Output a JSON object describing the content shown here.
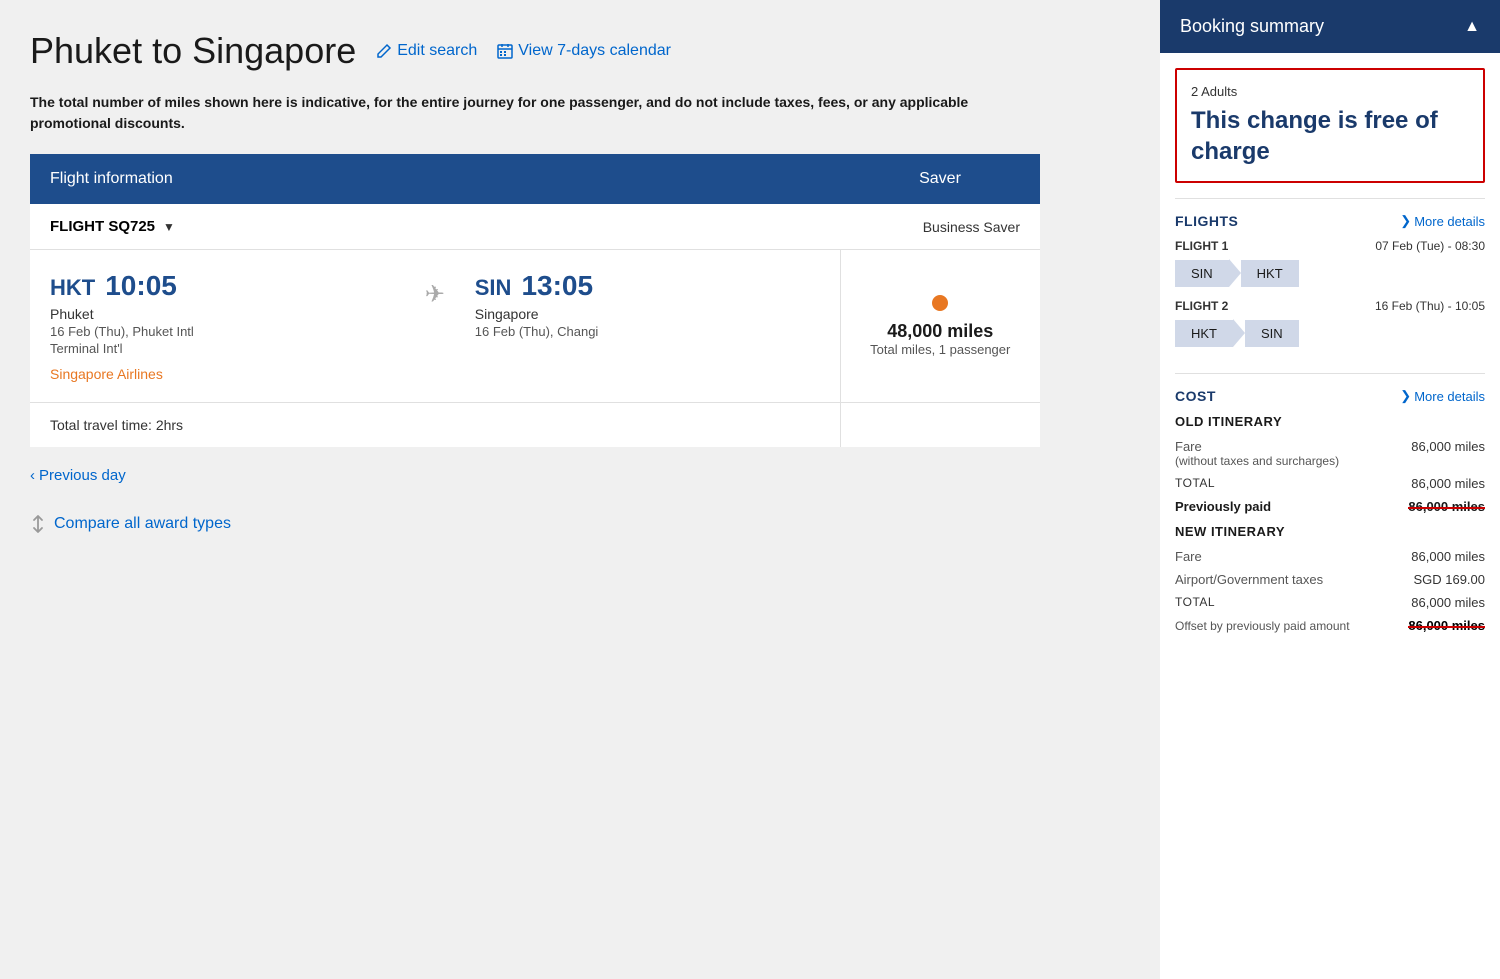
{
  "page": {
    "title": "Phuket to Singapore",
    "edit_search_label": "Edit search",
    "calendar_label": "View 7-days calendar",
    "disclaimer": "The total number of miles shown here is indicative, for the entire journey for one passenger, and do not include taxes, fees, or any applicable promotional discounts."
  },
  "table": {
    "header_flight_info": "Flight information",
    "header_saver": "Saver"
  },
  "flight": {
    "number": "FLIGHT SQ725",
    "fare_type": "Business Saver",
    "departure_code": "HKT",
    "departure_time": "10:05",
    "departure_city": "Phuket",
    "departure_date": "16 Feb (Thu), Phuket Intl",
    "departure_terminal": "Terminal Int'l",
    "arrival_code": "SIN",
    "arrival_time": "13:05",
    "arrival_city": "Singapore",
    "arrival_date": "16 Feb (Thu), Changi",
    "airline": "Singapore Airlines",
    "miles_amount": "48,000 miles",
    "miles_label": "Total miles, 1 passenger",
    "travel_time": "Total travel time: 2hrs"
  },
  "bottom_links": {
    "previous_day": "Previous day",
    "compare": "Compare all award types"
  },
  "sidebar": {
    "title": "Booking summary",
    "adults_label": "2 Adults",
    "free_charge_text": "This change is free of charge",
    "flights_section": "FLIGHTS",
    "more_details": "More details",
    "flight1_label": "FLIGHT 1",
    "flight1_date": "07 Feb (Tue) - 08:30",
    "flight1_from": "SIN",
    "flight1_to": "HKT",
    "flight2_label": "FLIGHT 2",
    "flight2_date": "16 Feb (Thu) - 10:05",
    "flight2_from": "HKT",
    "flight2_to": "SIN",
    "cost_section": "COST",
    "cost_more_details": "More details",
    "old_itinerary_label": "OLD ITINERARY",
    "fare_label": "Fare",
    "fare_sublabel": "(without taxes and surcharges)",
    "fare_value": "86,000 miles",
    "total_label": "TOTAL",
    "total_value": "86,000 miles",
    "previously_paid_label": "Previously paid",
    "previously_paid_value": "86,000 miles",
    "new_itinerary_label": "NEW ITINERARY",
    "new_fare_label": "Fare",
    "new_fare_value": "86,000 miles",
    "airport_tax_label": "Airport/Government taxes",
    "airport_tax_value": "SGD 169.00",
    "new_total_label": "TOTAL",
    "new_total_value": "86,000 miles",
    "offset_label": "Offset by previously paid amount",
    "offset_value": "86,000 miles"
  }
}
